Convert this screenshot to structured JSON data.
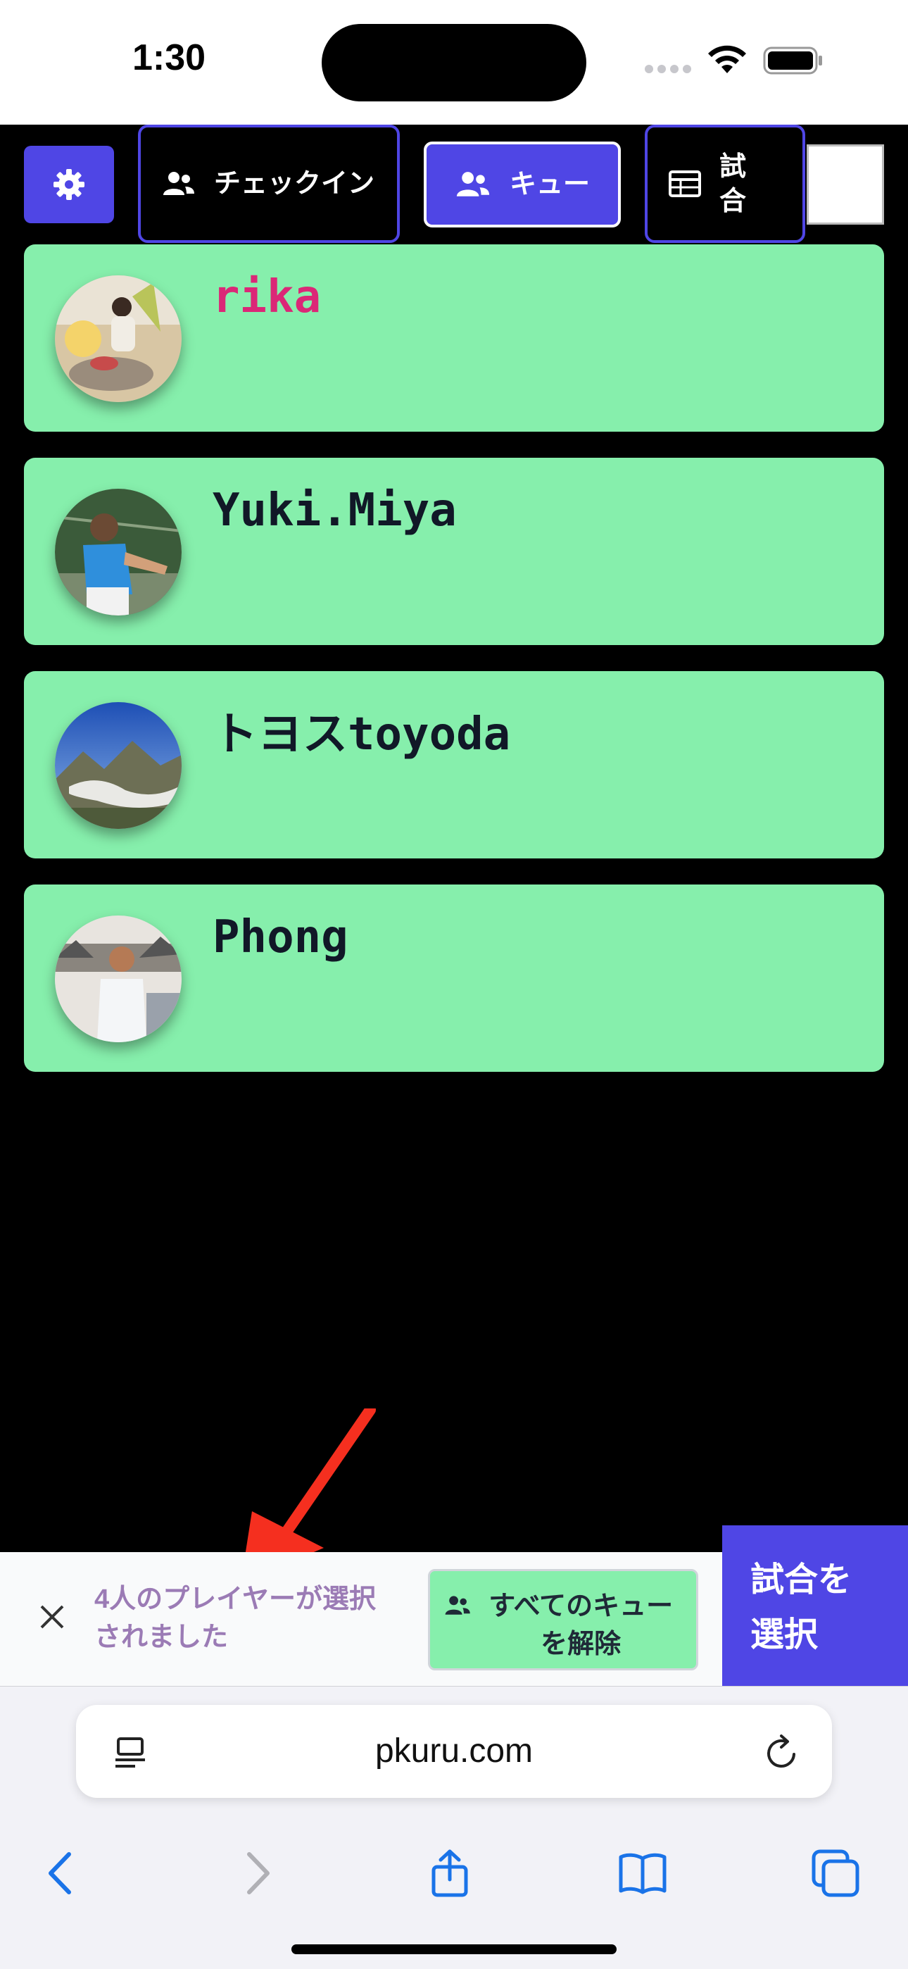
{
  "status_bar": {
    "time": "1:30"
  },
  "nav": {
    "checkin_label": "チェックイン",
    "queue_label": "キュー",
    "match_label": "試合"
  },
  "players": [
    {
      "name": "rika",
      "color": "#db2777"
    },
    {
      "name": "Yuki.Miya",
      "color": "#111827"
    },
    {
      "name": "トヨスtoyoda",
      "color": "#111827"
    },
    {
      "name": "Phong",
      "color": "#111827"
    }
  ],
  "selection_bar": {
    "message": "4人のプレイヤーが選択されました",
    "clear_queue_label": "すべてのキューを解除",
    "select_match_label": "試合を選択"
  },
  "browser": {
    "url": "pkuru.com"
  },
  "colors": {
    "accent": "#4f46e5",
    "card": "#86efac"
  }
}
